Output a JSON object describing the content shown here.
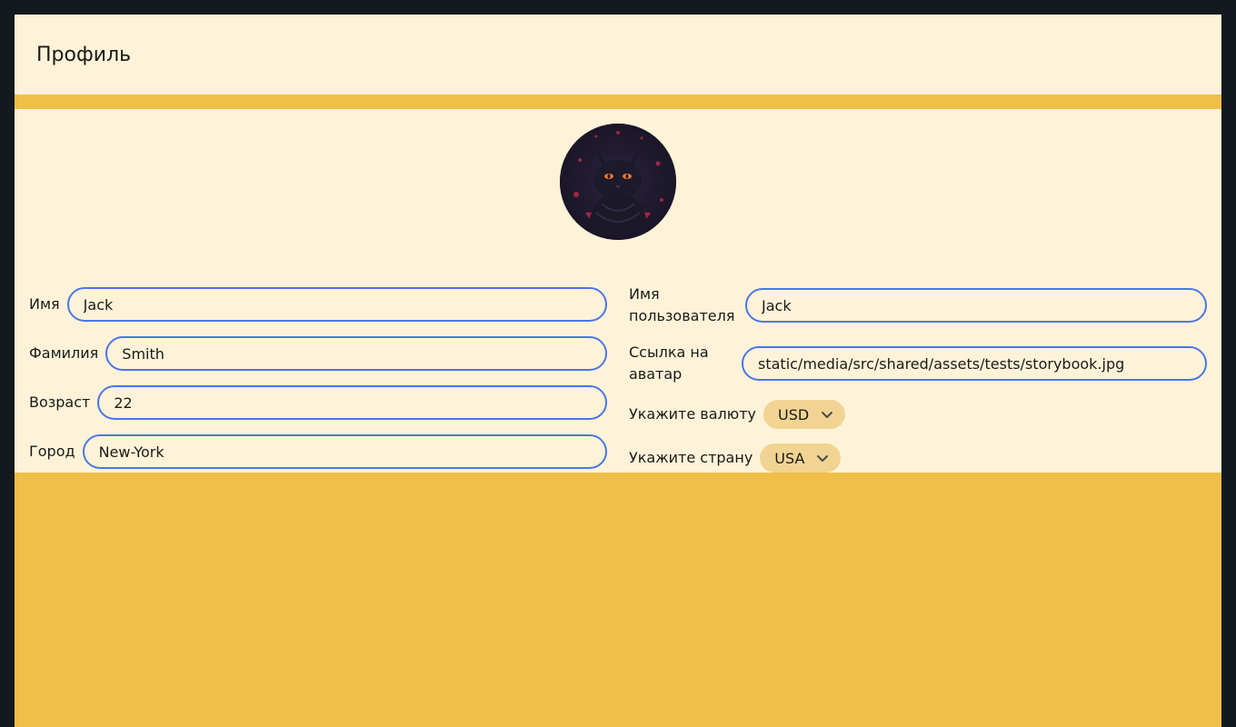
{
  "header": {
    "title": "Профиль"
  },
  "avatar": {
    "icon": "cat-avatar"
  },
  "form_left": {
    "first_name": {
      "label": "Имя",
      "value": "Jack"
    },
    "last_name": {
      "label": "Фамилия",
      "value": "Smith"
    },
    "age": {
      "label": "Возраст",
      "value": "22"
    },
    "city": {
      "label": "Город",
      "value": "New-York"
    }
  },
  "form_right": {
    "username": {
      "label": "Имя пользователя",
      "value": "Jack"
    },
    "avatar_link": {
      "label": "Ссылка на аватар",
      "value": "static/media/src/shared/assets/tests/storybook.jpg"
    },
    "currency": {
      "label": "Укажите валюту",
      "value": "USD"
    },
    "country": {
      "label": "Укажите страну",
      "value": "USA"
    }
  },
  "colors": {
    "page_bg": "#13191d",
    "accent": "#f0bf49",
    "card_bg": "#fef3d8",
    "input_border": "#4a76e8",
    "select_bg": "#f1d492"
  }
}
